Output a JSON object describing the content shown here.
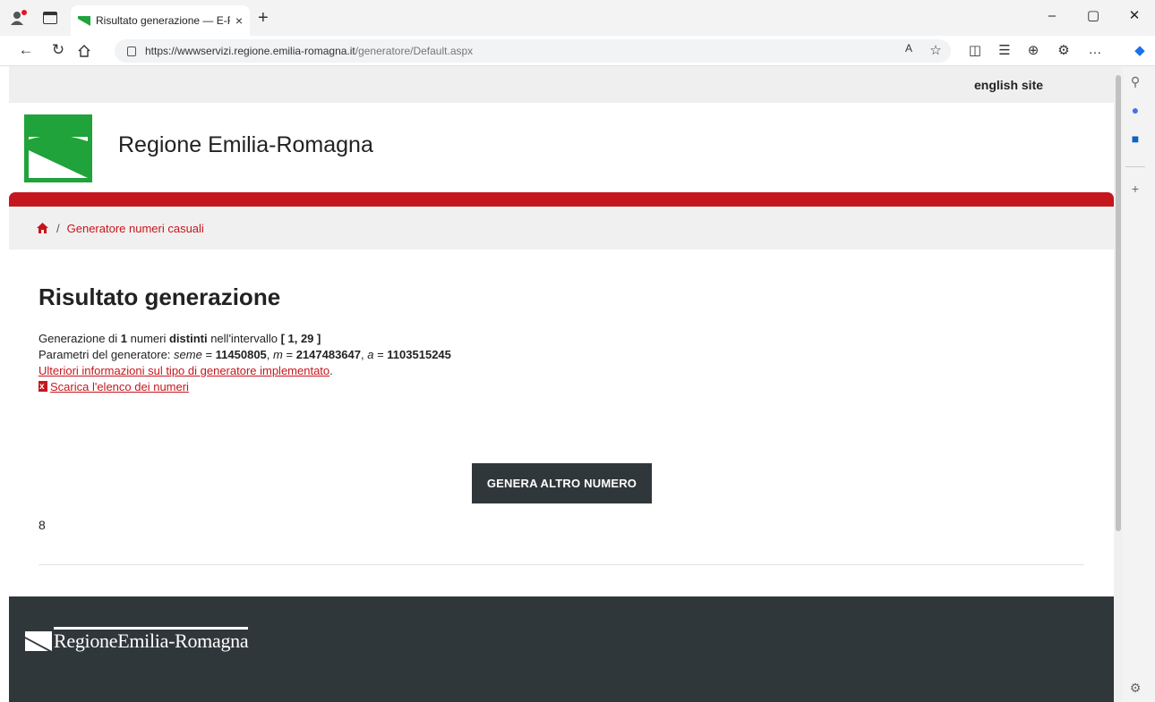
{
  "browser": {
    "tab_title": "Risultato generazione — E-R Il p",
    "tab_close": "×",
    "new_tab": "+",
    "url_host": "https://wwwservizi.regione.emilia-romagna.it",
    "url_path": "/generatore/Default.aspx",
    "window_controls": [
      "–",
      "▢",
      "✕"
    ]
  },
  "page": {
    "english_link": "english site",
    "brand_name": "Regione Emilia-Romagna",
    "breadcrumb": {
      "separator": "/",
      "current": "Generatore numeri casuali"
    },
    "title": "Risultato generazione",
    "generation": {
      "prefix": "Generazione di ",
      "count": "1",
      "mid": " numeri ",
      "distinct": "distinti",
      "mid2": " nell'intervallo ",
      "interval": "[ 1, 29 ]"
    },
    "params": {
      "prefix": "Parametri del generatore: ",
      "seed_label": "seme",
      "seed_eq": " = ",
      "seed_value": "11450805",
      "m_label": "m",
      "m_eq": " = ",
      "m_value": "2147483647",
      "a_label": "a",
      "a_eq": " = ",
      "a_value": "1103515245",
      "sep": ", "
    },
    "info_link": "Ulteriori informazioni sul tipo di generatore implementato",
    "info_link_suffix": ".",
    "download_link": "Scarica l'elenco dei numeri",
    "generate_button": "GENERA ALTRO NUMERO",
    "result": "8",
    "footer_logo": "RegioneEmilia-Romagna"
  },
  "colors": {
    "accent_red": "#c6161d",
    "brand_green": "#1fa33a",
    "dark": "#30373b"
  }
}
